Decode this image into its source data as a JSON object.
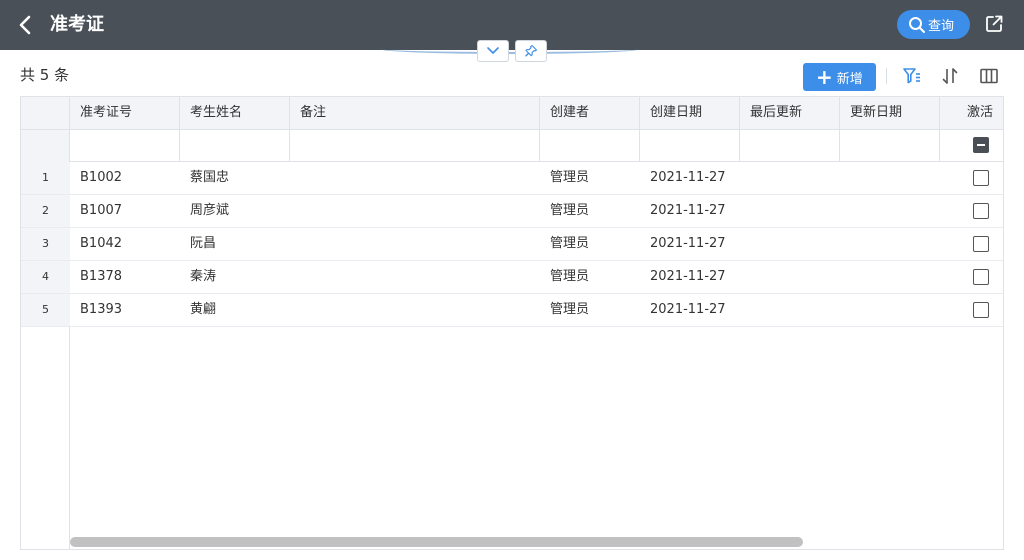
{
  "header": {
    "title": "准考证",
    "query_label": "查询"
  },
  "toolbar": {
    "record_count": "共 5 条",
    "add_label": "新增"
  },
  "table": {
    "columns": [
      {
        "label": "准考证号"
      },
      {
        "label": "考生姓名"
      },
      {
        "label": "备注"
      },
      {
        "label": "创建者"
      },
      {
        "label": "创建日期"
      },
      {
        "label": "最后更新"
      },
      {
        "label": "更新日期"
      },
      {
        "label": "激活"
      }
    ],
    "rows": [
      {
        "num": "1",
        "id": "B1002",
        "name": "蔡国忠",
        "note": "",
        "creator": "管理员",
        "created": "2021-11-27",
        "updater": "",
        "updated": "",
        "active": false
      },
      {
        "num": "2",
        "id": "B1007",
        "name": "周彦斌",
        "note": "",
        "creator": "管理员",
        "created": "2021-11-27",
        "updater": "",
        "updated": "",
        "active": false
      },
      {
        "num": "3",
        "id": "B1042",
        "name": "阮昌",
        "note": "",
        "creator": "管理员",
        "created": "2021-11-27",
        "updater": "",
        "updated": "",
        "active": false
      },
      {
        "num": "4",
        "id": "B1378",
        "name": "秦涛",
        "note": "",
        "creator": "管理员",
        "created": "2021-11-27",
        "updater": "",
        "updated": "",
        "active": false
      },
      {
        "num": "5",
        "id": "B1393",
        "name": "黄翩",
        "note": "",
        "creator": "管理员",
        "created": "2021-11-27",
        "updater": "",
        "updated": "",
        "active": false
      }
    ]
  },
  "icons": {
    "back": "chevron-left-icon",
    "query": "search-icon",
    "share": "external-link-icon",
    "collapse": "chevron-down-icon",
    "pin": "pin-icon",
    "add": "plus-icon",
    "filter": "filter-icon",
    "sort": "sort-icon",
    "columns": "columns-icon"
  },
  "colors": {
    "topbar": "#495058",
    "accent": "#3d8ee8",
    "header_bg": "#f2f4f7",
    "border": "#dfe3e8"
  }
}
